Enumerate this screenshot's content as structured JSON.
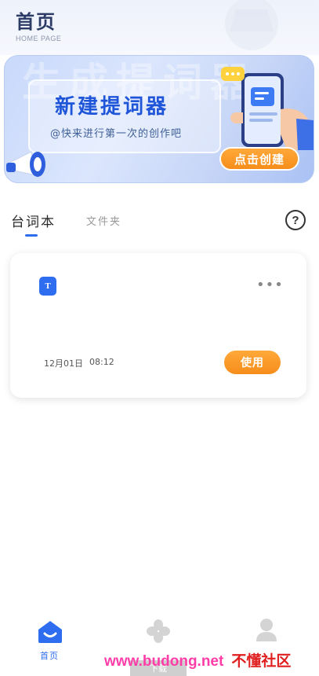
{
  "header": {
    "title": "首页",
    "subtitle": "HOME PAGE"
  },
  "banner": {
    "title": "新建提词器",
    "subtitle": "@快来进行第一次的创作吧",
    "cta_label": "点击创建",
    "ghost_text": "生成提词器"
  },
  "tabs": [
    {
      "label": "台词本",
      "active": true
    },
    {
      "label": "文件夹",
      "active": false
    }
  ],
  "help_label": "?",
  "script_card": {
    "icon_letter": "T",
    "name": "",
    "more": "•••",
    "date": "12月01日",
    "time": "08:12",
    "use_label": "使用"
  },
  "bottom_nav": {
    "home_label": "首页",
    "download_label": "下载"
  },
  "watermark": {
    "url": "www.budong.net",
    "name": "不懂社区"
  },
  "colors": {
    "accent": "#2f6df0",
    "button": "#f68d1a"
  }
}
